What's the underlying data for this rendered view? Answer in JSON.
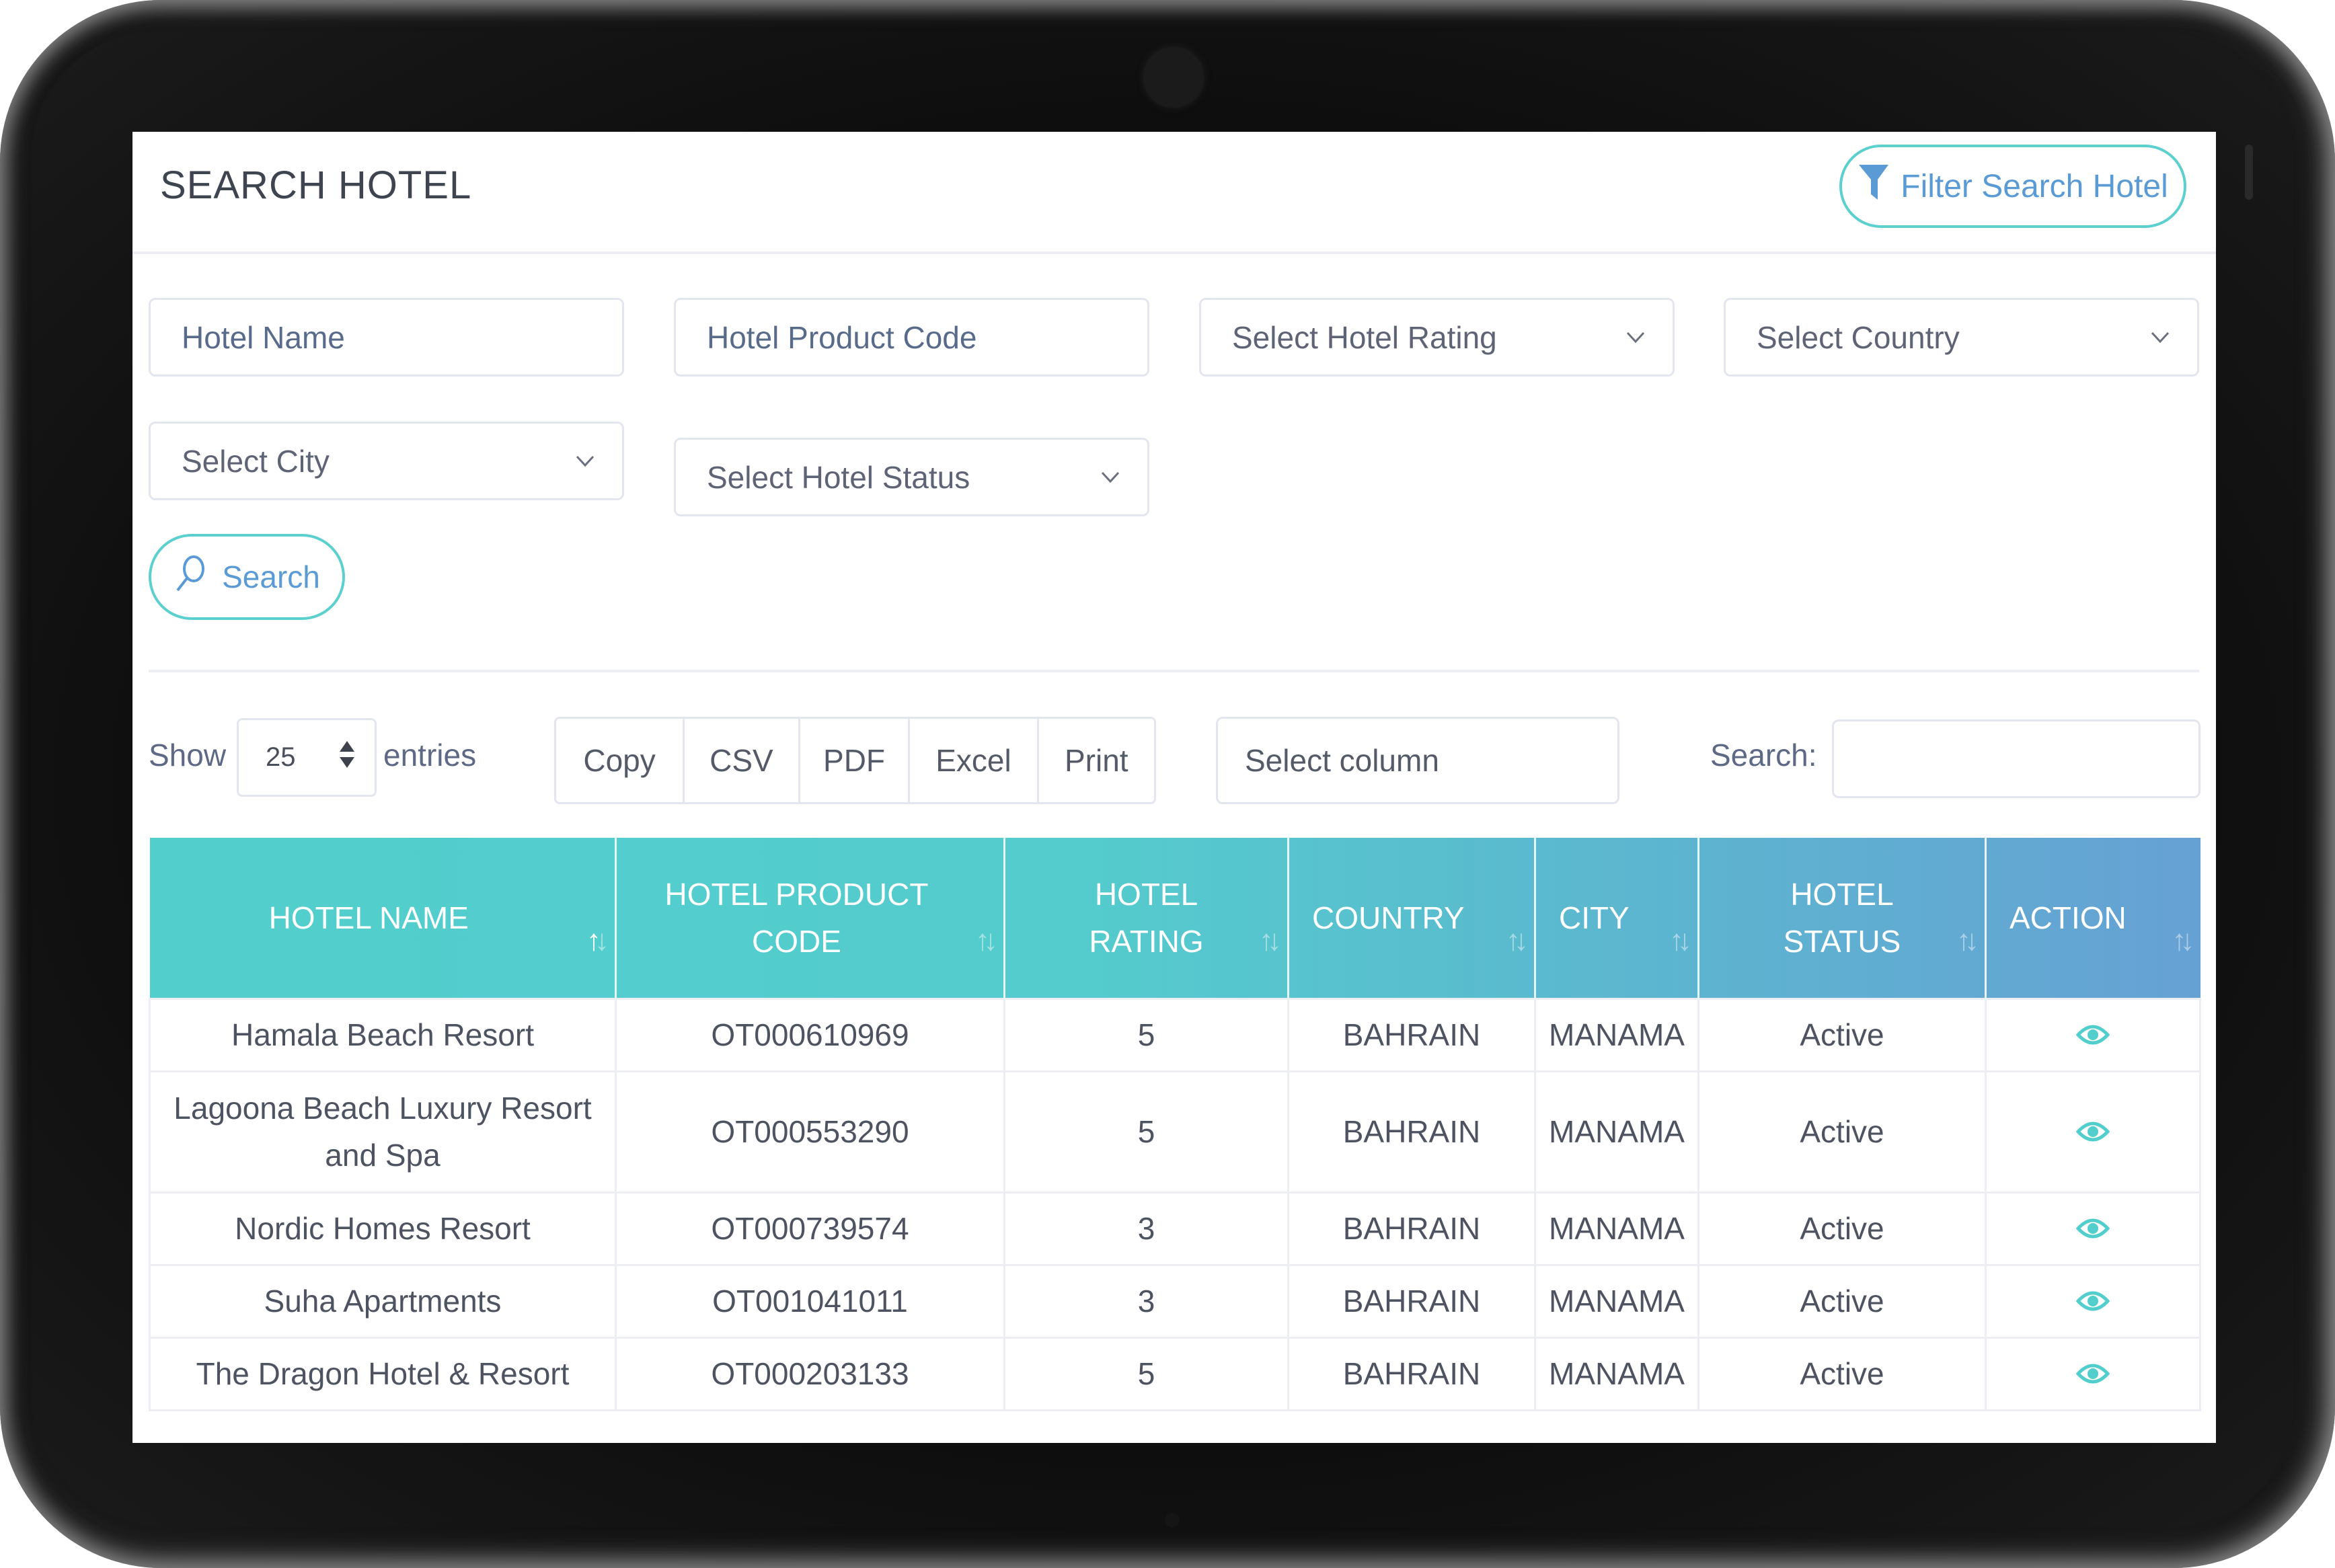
{
  "header": {
    "title": "SEARCH HOTEL",
    "filter_button_label": "Filter Search Hotel",
    "filter_icon": "funnel-icon"
  },
  "filters": {
    "hotel_name": {
      "placeholder": "Hotel Name",
      "value": ""
    },
    "hotel_product_code": {
      "placeholder": "Hotel Product Code",
      "value": ""
    },
    "hotel_rating": {
      "selected": "Select Hotel Rating"
    },
    "country": {
      "selected": "Select Country"
    },
    "city": {
      "selected": "Select City"
    },
    "hotel_status": {
      "selected": "Select Hotel Status"
    },
    "search_button_label": "Search",
    "search_icon": "magnifier-icon"
  },
  "table_controls": {
    "show_label": "Show",
    "entries_value": "25",
    "entries_label": "entries",
    "export_buttons": [
      "Copy",
      "CSV",
      "PDF",
      "Excel",
      "Print"
    ],
    "select_column": "Select column",
    "search_label": "Search:",
    "search_value": ""
  },
  "table": {
    "columns": [
      "HOTEL NAME",
      "HOTEL PRODUCT CODE",
      "HOTEL RATING",
      "COUNTRY",
      "CITY",
      "HOTEL STATUS",
      "ACTION"
    ],
    "sorted_column": "HOTEL NAME",
    "rows": [
      {
        "name": "Hamala Beach Resort",
        "code": "OT000610969",
        "rating": "5",
        "country": "BAHRAIN",
        "city": "MANAMA",
        "status": "Active",
        "action": "view-icon"
      },
      {
        "name": "Lagoona Beach Luxury Resort and Spa",
        "code": "OT000553290",
        "rating": "5",
        "country": "BAHRAIN",
        "city": "MANAMA",
        "status": "Active",
        "action": "view-icon"
      },
      {
        "name": "Nordic Homes Resort",
        "code": "OT000739574",
        "rating": "3",
        "country": "BAHRAIN",
        "city": "MANAMA",
        "status": "Active",
        "action": "view-icon"
      },
      {
        "name": "Suha Apartments",
        "code": "OT001041011",
        "rating": "3",
        "country": "BAHRAIN",
        "city": "MANAMA",
        "status": "Active",
        "action": "view-icon"
      },
      {
        "name": "The Dragon Hotel & Resort",
        "code": "OT000203133",
        "rating": "5",
        "country": "BAHRAIN",
        "city": "MANAMA",
        "status": "Active",
        "action": "view-icon"
      }
    ]
  },
  "colors": {
    "accent_teal": "#52cecd",
    "accent_blue": "#5b9bd5",
    "header_gradient_end": "#66a1d4",
    "text": "#4e5361"
  }
}
